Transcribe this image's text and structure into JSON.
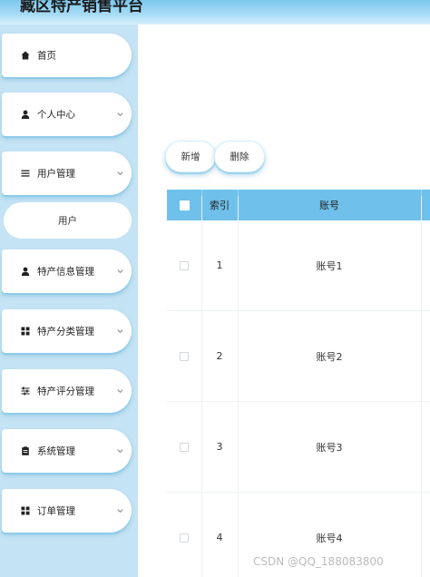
{
  "header": {
    "title": "臧区特产销售平台"
  },
  "sidebar": {
    "items": [
      {
        "label": "首页",
        "icon": "home-icon",
        "expandable": false
      },
      {
        "label": "个人中心",
        "icon": "user-icon",
        "expandable": true
      },
      {
        "label": "用户管理",
        "icon": "list-icon",
        "expandable": true
      },
      {
        "label": "特产信息管理",
        "icon": "user-icon",
        "expandable": true
      },
      {
        "label": "特产分类管理",
        "icon": "grid-icon",
        "expandable": true
      },
      {
        "label": "特产评分管理",
        "icon": "sliders-icon",
        "expandable": true
      },
      {
        "label": "系统管理",
        "icon": "clipboard-icon",
        "expandable": true
      },
      {
        "label": "订单管理",
        "icon": "grid-icon",
        "expandable": true
      }
    ],
    "sub_item": {
      "label": "用户"
    }
  },
  "toolbar": {
    "add_label": "新增",
    "delete_label": "删除"
  },
  "table": {
    "columns": [
      "索引",
      "账号"
    ],
    "rows": [
      {
        "index": "1",
        "account": "账号1"
      },
      {
        "index": "2",
        "account": "账号2"
      },
      {
        "index": "3",
        "account": "账号3"
      },
      {
        "index": "4",
        "account": "账号4"
      }
    ]
  },
  "watermark": "CSDN @QQ_188083800",
  "colors": {
    "accent": "#6fc0ea",
    "sidebar_bg": "#c4e3f4",
    "header_gradient_top": "#7cc8ee"
  }
}
